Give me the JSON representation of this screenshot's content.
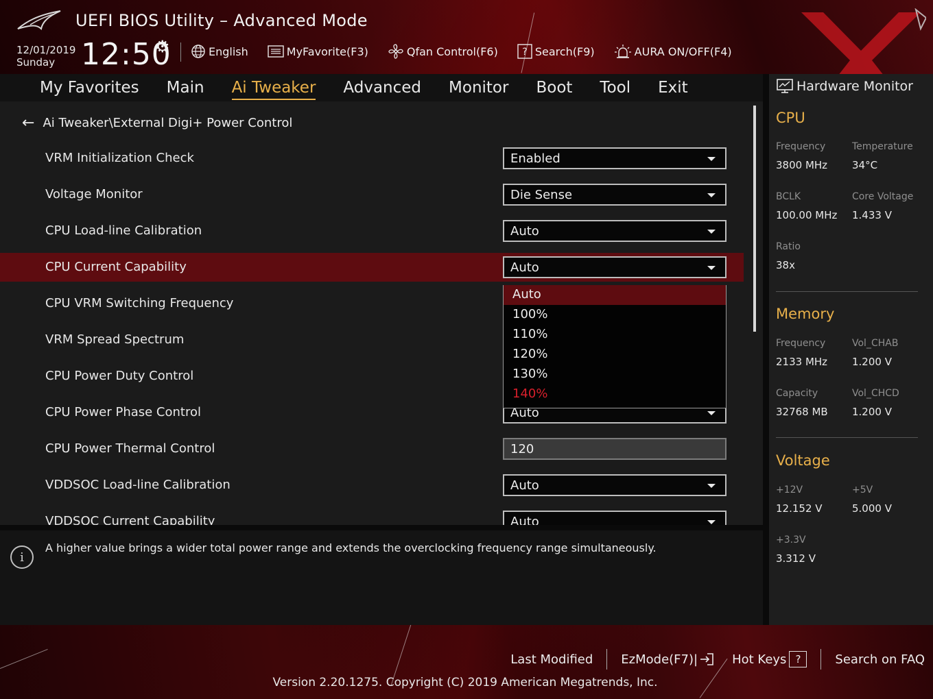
{
  "header": {
    "title": "UEFI BIOS Utility – Advanced Mode",
    "date": "12/01/2019",
    "day": "Sunday",
    "time": "12:50",
    "toolbar": [
      {
        "label": "English",
        "icon": "globe-icon"
      },
      {
        "label": "MyFavorite(F3)",
        "icon": "favorite-list-icon"
      },
      {
        "label": "Qfan Control(F6)",
        "icon": "fan-icon"
      },
      {
        "label": "Search(F9)",
        "icon": "question-search-icon"
      },
      {
        "label": "AURA ON/OFF(F4)",
        "icon": "aura-light-icon"
      }
    ]
  },
  "menu": {
    "items": [
      "My Favorites",
      "Main",
      "Ai Tweaker",
      "Advanced",
      "Monitor",
      "Boot",
      "Tool",
      "Exit"
    ],
    "active": "Ai Tweaker"
  },
  "main": {
    "breadcrumb": "Ai Tweaker\\External Digi+ Power Control",
    "settings": [
      {
        "label": "VRM Initialization Check",
        "value": "Enabled"
      },
      {
        "label": "Voltage Monitor",
        "value": "Die Sense"
      },
      {
        "label": "CPU Load-line Calibration",
        "value": "Auto"
      },
      {
        "label": "CPU Current Capability",
        "value": "Auto"
      },
      {
        "label": "CPU VRM Switching Frequency",
        "value": ""
      },
      {
        "label": "VRM Spread Spectrum",
        "value": ""
      },
      {
        "label": "CPU Power Duty Control",
        "value": ""
      },
      {
        "label": "CPU Power Phase Control",
        "value": "Auto"
      },
      {
        "label": "CPU Power Thermal Control",
        "value": "120"
      },
      {
        "label": "VDDSOC Load-line Calibration",
        "value": "Auto"
      },
      {
        "label": "VDDSOC Current Capability",
        "value": "Auto"
      }
    ],
    "dropdown": {
      "options": [
        "Auto",
        "100%",
        "110%",
        "120%",
        "130%",
        "140%"
      ],
      "selected": "Auto",
      "hovered": "140%"
    }
  },
  "info": {
    "text": "A higher value brings a wider total power range and extends the overclocking frequency range simultaneously."
  },
  "hw_monitor": {
    "title": "Hardware Monitor",
    "cpu": {
      "title": "CPU",
      "frequency_label": "Frequency",
      "frequency": "3800 MHz",
      "temperature_label": "Temperature",
      "temperature": "34°C",
      "bclk_label": "BCLK",
      "bclk": "100.00 MHz",
      "core_voltage_label": "Core Voltage",
      "core_voltage": "1.433 V",
      "ratio_label": "Ratio",
      "ratio": "38x"
    },
    "memory": {
      "title": "Memory",
      "frequency_label": "Frequency",
      "frequency": "2133 MHz",
      "vol_chab_label": "Vol_CHAB",
      "vol_chab": "1.200 V",
      "capacity_label": "Capacity",
      "capacity": "32768 MB",
      "vol_chcd_label": "Vol_CHCD",
      "vol_chcd": "1.200 V"
    },
    "voltage": {
      "title": "Voltage",
      "v12_label": "+12V",
      "v12": "12.152 V",
      "v5_label": "+5V",
      "v5": "5.000 V",
      "v33_label": "+3.3V",
      "v33": "3.312 V"
    }
  },
  "footer": {
    "last_modified": "Last Modified",
    "ezmode": "EzMode(F7)|",
    "hot_keys": "Hot Keys",
    "hot_keys_key": "?",
    "search_faq": "Search on FAQ",
    "version": "Version 2.20.1275. Copyright (C) 2019 American Megatrends, Inc."
  },
  "colors": {
    "accent": "#e8b04a",
    "highlight_row": "#5e0c10",
    "hover_option": "#d8202c"
  }
}
